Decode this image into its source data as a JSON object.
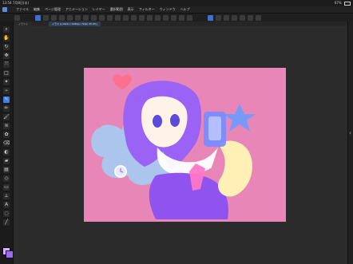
{
  "status": {
    "time": "13:54",
    "date": "7月8日(水)",
    "right": "67%"
  },
  "menu": {
    "items": [
      "ファイル",
      "編集",
      "ページ管理",
      "アニメーション",
      "レイヤー",
      "選択範囲",
      "表示",
      "フィルター",
      "ウィンドウ",
      "ヘルプ"
    ]
  },
  "tabs": [
    {
      "label": "イラスト",
      "state": "inactive"
    },
    {
      "label": "イラスト(1920 x 1080px 72dpi 25.0%)",
      "state": "active"
    }
  ],
  "colors": {
    "canvas_bg": "#e886b7",
    "ui_bg": "#2b2b2b",
    "accent": "#3e7ee8",
    "primary_color": "#d6b1ff",
    "secondary_color": "#9f68f7"
  },
  "icons": {
    "left_tools": [
      "search-icon",
      "hand-icon",
      "rotate-icon",
      "move-icon",
      "transform-icon",
      "selection-icon",
      "wand-icon",
      "eyedropper-icon",
      "pen-icon",
      "pencil-icon",
      "brush-icon",
      "airbrush-icon",
      "decoration-icon",
      "eraser-icon",
      "blend-icon",
      "fill-icon",
      "gradient-icon",
      "shape-icon",
      "frame-icon",
      "ruler-icon",
      "text-icon",
      "balloon-icon",
      "line-icon"
    ]
  },
  "canvas": {
    "name": "anime-illustration"
  }
}
